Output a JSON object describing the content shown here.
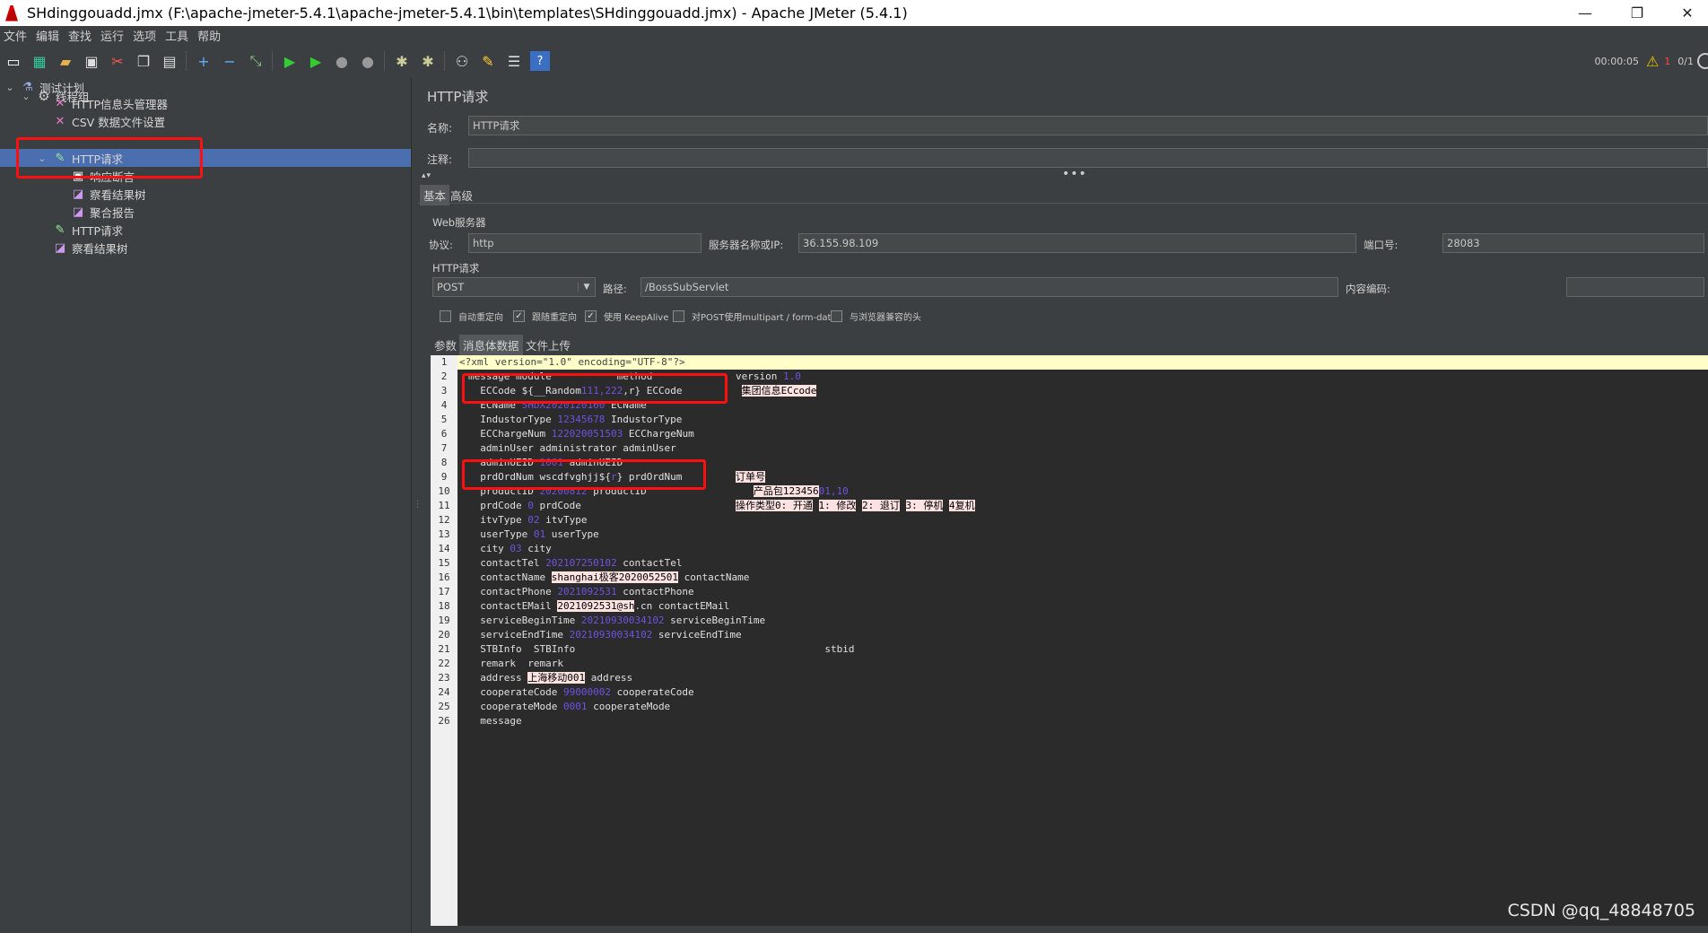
{
  "window": {
    "title": "SHdinggouadd.jmx (F:\\apache-jmeter-5.4.1\\apache-jmeter-5.4.1\\bin\\templates\\SHdinggouadd.jmx) - Apache JMeter (5.4.1)",
    "minimize": "—",
    "restore": "❐",
    "close": "✕"
  },
  "menu": [
    "文件",
    "编辑",
    "查找",
    "运行",
    "选项",
    "工具",
    "帮助"
  ],
  "status": {
    "timer": "00:00:05",
    "warn_count": "1",
    "threads": "0/1"
  },
  "tree": {
    "items": [
      {
        "label": "测试计划"
      },
      {
        "label": "线程组"
      },
      {
        "label": "HTTP信息头管理器"
      },
      {
        "label": "CSV 数据文件设置"
      },
      {
        "label": "HTTP请求"
      },
      {
        "label": "响应断言"
      },
      {
        "label": "察看结果树"
      },
      {
        "label": "聚合报告"
      },
      {
        "label": "HTTP请求"
      },
      {
        "label": "察看结果树"
      }
    ]
  },
  "panel": {
    "title": "HTTP请求",
    "name_label": "名称:",
    "name_value": "HTTP请求",
    "comment_label": "注释:",
    "comment_value": "",
    "tabs": [
      "基本",
      "高级"
    ],
    "web_server": "Web服务器",
    "protocol_label": "协议:",
    "protocol_value": "http",
    "server_label": "服务器名称或IP:",
    "server_value": "36.155.98.109",
    "port_label": "端口号:",
    "port_value": "28083",
    "http_request": "HTTP请求",
    "method_value": "POST",
    "path_label": "路径:",
    "path_value": "/BossSubServlet",
    "encoding_label": "内容编码:",
    "encoding_value": "",
    "checkboxes": [
      {
        "label": "自动重定向",
        "checked": ""
      },
      {
        "label": "跟随重定向",
        "checked": "✓"
      },
      {
        "label": "使用 KeepAlive",
        "checked": "✓"
      },
      {
        "label": "对POST使用multipart / form-data",
        "checked": ""
      },
      {
        "label": "与浏览器兼容的头",
        "checked": ""
      }
    ],
    "subtabs": [
      "参数",
      "消息体数据",
      "文件上传"
    ]
  },
  "editor": {
    "line1": "<?xml version=\"1.0\" encoding=\"UTF-8\"?>",
    "lines": {
      "l2": {
        "a": "message module ",
        "b": "         ",
        "c": " method ",
        "d": "            ",
        "e": " version ",
        "f": "1.0"
      },
      "l3": {
        "a": "ECCode ${",
        "b": "__Random",
        "c": "111,222",
        "d": ",r}",
        "e": " ECCode",
        "f": "集团信息ECcode"
      },
      "l4": {
        "a": "ECName ",
        "b": "SHDX2020120160",
        "c": " ECName"
      },
      "l5": {
        "a": "IndustorType ",
        "b": "12345678",
        "c": " IndustorType"
      },
      "l6": {
        "a": "ECChargeNum ",
        "b": "122020051503",
        "c": " ECChargeNum"
      },
      "l7": {
        "a": "adminUser administrator",
        "b": " adminUser"
      },
      "l8": {
        "a": "adminUEID ",
        "b": "1001",
        "c": " adminUEID"
      },
      "l9": {
        "a": "prdOrdNum wscdfvghjj${",
        "b": "r",
        "c": "} prdOrdNum",
        "d": "订单号"
      },
      "l10": {
        "a": "productID ",
        "b": "20200812",
        "c": " productID",
        "d": "产品包123456",
        "e": "01,10"
      },
      "l11": {
        "a": "prdCode ",
        "b": "0",
        "c": " prdCode",
        "d": "操作类型0: 开通",
        "e": "1: 修改",
        "f": "2: 退订",
        "g": "3: 停机",
        "h": "4复机"
      },
      "l12": {
        "a": "itvType ",
        "b": "02",
        "c": " itvType"
      },
      "l13": {
        "a": "userType ",
        "b": "01",
        "c": " userType"
      },
      "l14": {
        "a": "city ",
        "b": "03",
        "c": " city"
      },
      "l15": {
        "a": "contactTel ",
        "b": "202107250102",
        "c": " contactTel"
      },
      "l16": {
        "a": "contactName ",
        "b": "shanghai极客2020052501",
        "c": " contactName"
      },
      "l17": {
        "a": "contactPhone ",
        "b": "2021092531",
        "c": " contactPhone"
      },
      "l18": {
        "a": "contactEMail ",
        "b": "2021092531@sh",
        "c": ".cn",
        "d": " contactEMail"
      },
      "l19": {
        "a": "serviceBeginTime ",
        "b": "20210930034102",
        "c": " serviceBeginTime"
      },
      "l20": {
        "a": "serviceEndTime ",
        "b": "20210930034102",
        "c": " serviceEndTime"
      },
      "l21": {
        "a": "STBInfo ",
        "b": " STBInfo",
        "c": "stbid"
      },
      "l22": {
        "a": "remark ",
        "b": " remark"
      },
      "l23": {
        "a": "address ",
        "b": "上海移动001",
        "c": " address"
      },
      "l24": {
        "a": "cooperateCode ",
        "b": "99000002",
        "c": " cooperateCode"
      },
      "l25": {
        "a": "cooperateMode ",
        "b": "0001",
        "c": " cooperateMode"
      },
      "l26": {
        "a": "message"
      }
    }
  },
  "watermark": "CSDN @qq_48848705"
}
